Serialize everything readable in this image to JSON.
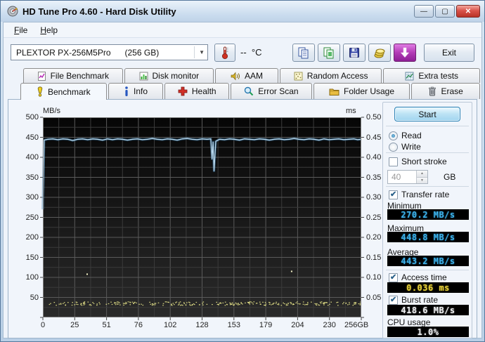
{
  "window": {
    "title": "HD Tune Pro 4.60 - Hard Disk Utility",
    "controls": {
      "minimize": "—",
      "maximize": "▢",
      "close": "✕"
    }
  },
  "menu": {
    "items": [
      {
        "label": "File"
      },
      {
        "label": "Help"
      }
    ]
  },
  "toolbar": {
    "drive_selected": "PLEXTOR PX-256M5Pro      (256 GB)",
    "temperature": "--  °C",
    "exit_label": "Exit"
  },
  "tabs": {
    "top": [
      {
        "label": "File Benchmark"
      },
      {
        "label": "Disk monitor"
      },
      {
        "label": "AAM"
      },
      {
        "label": "Random Access"
      },
      {
        "label": "Extra tests"
      }
    ],
    "bottom": [
      {
        "label": "Benchmark",
        "active": true
      },
      {
        "label": "Info"
      },
      {
        "label": "Health"
      },
      {
        "label": "Error Scan"
      },
      {
        "label": "Folder Usage"
      },
      {
        "label": "Erase"
      }
    ]
  },
  "panel": {
    "start_label": "Start",
    "read_label": "Read",
    "write_label": "Write",
    "short_stroke_label": "Short stroke",
    "short_stroke_value": "40",
    "short_stroke_unit": "GB",
    "transfer_rate_label": "Transfer rate",
    "minimum_label": "Minimum",
    "minimum_value": "270.2 MB/s",
    "maximum_label": "Maximum",
    "maximum_value": "448.8 MB/s",
    "average_label": "Average",
    "average_value": "443.2 MB/s",
    "access_time_label": "Access time",
    "access_time_value": "0.036 ms",
    "burst_rate_label": "Burst rate",
    "burst_rate_value": "418.6 MB/s",
    "cpu_usage_label": "CPU usage",
    "cpu_usage_value": "1.0%",
    "checks": {
      "short_stroke": false,
      "transfer_rate": true,
      "access_time": true,
      "burst_rate": true
    },
    "radios": {
      "read": true,
      "write": false
    }
  },
  "chart_data": {
    "type": "line",
    "title": "HD Tune benchmark transfer rate / access time",
    "x_range": [
      0,
      256
    ],
    "x_ticks": [
      "0",
      "25",
      "51",
      "76",
      "102",
      "128",
      "153",
      "179",
      "204",
      "230",
      "256GB"
    ],
    "left_axis": {
      "label": "MB/s",
      "range": [
        0,
        500
      ],
      "ticks": [
        "500",
        "450",
        "400",
        "350",
        "300",
        "250",
        "200",
        "150",
        "100",
        "50"
      ]
    },
    "right_axis": {
      "label": "ms",
      "range": [
        0,
        0.5
      ],
      "ticks": [
        "0.50",
        "0.45",
        "0.40",
        "0.35",
        "0.30",
        "0.25",
        "0.20",
        "0.15",
        "0.10",
        "0.05"
      ]
    },
    "grid": {
      "x_divisions": 20,
      "y_divisions": 20,
      "major_every": 2,
      "major_color": "#5a5a5a",
      "minor_color": "#3b3b3b"
    },
    "transfer_rate": {
      "name": "Transfer rate (MB/s)",
      "color": "#b9d9ef",
      "glow_color": "#3d7fae",
      "points": [
        [
          0,
          270
        ],
        [
          1,
          443
        ],
        [
          4,
          445
        ],
        [
          8,
          446
        ],
        [
          12,
          444
        ],
        [
          16,
          446
        ],
        [
          20,
          445
        ],
        [
          24,
          442
        ],
        [
          28,
          445
        ],
        [
          32,
          446
        ],
        [
          36,
          444
        ],
        [
          40,
          446
        ],
        [
          44,
          445
        ],
        [
          48,
          443
        ],
        [
          52,
          446
        ],
        [
          56,
          444
        ],
        [
          60,
          446
        ],
        [
          64,
          445
        ],
        [
          68,
          443
        ],
        [
          72,
          445
        ],
        [
          76,
          446
        ],
        [
          80,
          444
        ],
        [
          84,
          445
        ],
        [
          88,
          447
        ],
        [
          92,
          445
        ],
        [
          96,
          444
        ],
        [
          100,
          446
        ],
        [
          104,
          445
        ],
        [
          108,
          443
        ],
        [
          112,
          446
        ],
        [
          116,
          447
        ],
        [
          120,
          445
        ],
        [
          124,
          444
        ],
        [
          128,
          446
        ],
        [
          132,
          445
        ],
        [
          135,
          446
        ],
        [
          136,
          396
        ],
        [
          136.8,
          438
        ],
        [
          137.6,
          366
        ],
        [
          139,
          440
        ],
        [
          142,
          445
        ],
        [
          146,
          444
        ],
        [
          150,
          446
        ],
        [
          154,
          445
        ],
        [
          158,
          443
        ],
        [
          162,
          446
        ],
        [
          166,
          445
        ],
        [
          170,
          444
        ],
        [
          174,
          446
        ],
        [
          178,
          445
        ],
        [
          182,
          443
        ],
        [
          186,
          445
        ],
        [
          190,
          446
        ],
        [
          194,
          444
        ],
        [
          198,
          445
        ],
        [
          202,
          447
        ],
        [
          206,
          445
        ],
        [
          210,
          444
        ],
        [
          214,
          446
        ],
        [
          218,
          445
        ],
        [
          222,
          443
        ],
        [
          226,
          446
        ],
        [
          230,
          444
        ],
        [
          234,
          445
        ],
        [
          238,
          446
        ],
        [
          242,
          444
        ],
        [
          246,
          445
        ],
        [
          250,
          446
        ],
        [
          253,
          444
        ],
        [
          256,
          445
        ]
      ]
    },
    "access_time_dots": {
      "name": "Access time (ms)",
      "color": "#ecea8c",
      "band": {
        "count": 260,
        "y_min": 0.031,
        "y_max": 0.04,
        "seed": 42
      },
      "outliers": [
        [
          35.6,
          0.108
        ],
        [
          200,
          0.115
        ]
      ]
    },
    "plot_background": {
      "top": "#060606",
      "bottom": "#2a2a2a"
    }
  }
}
